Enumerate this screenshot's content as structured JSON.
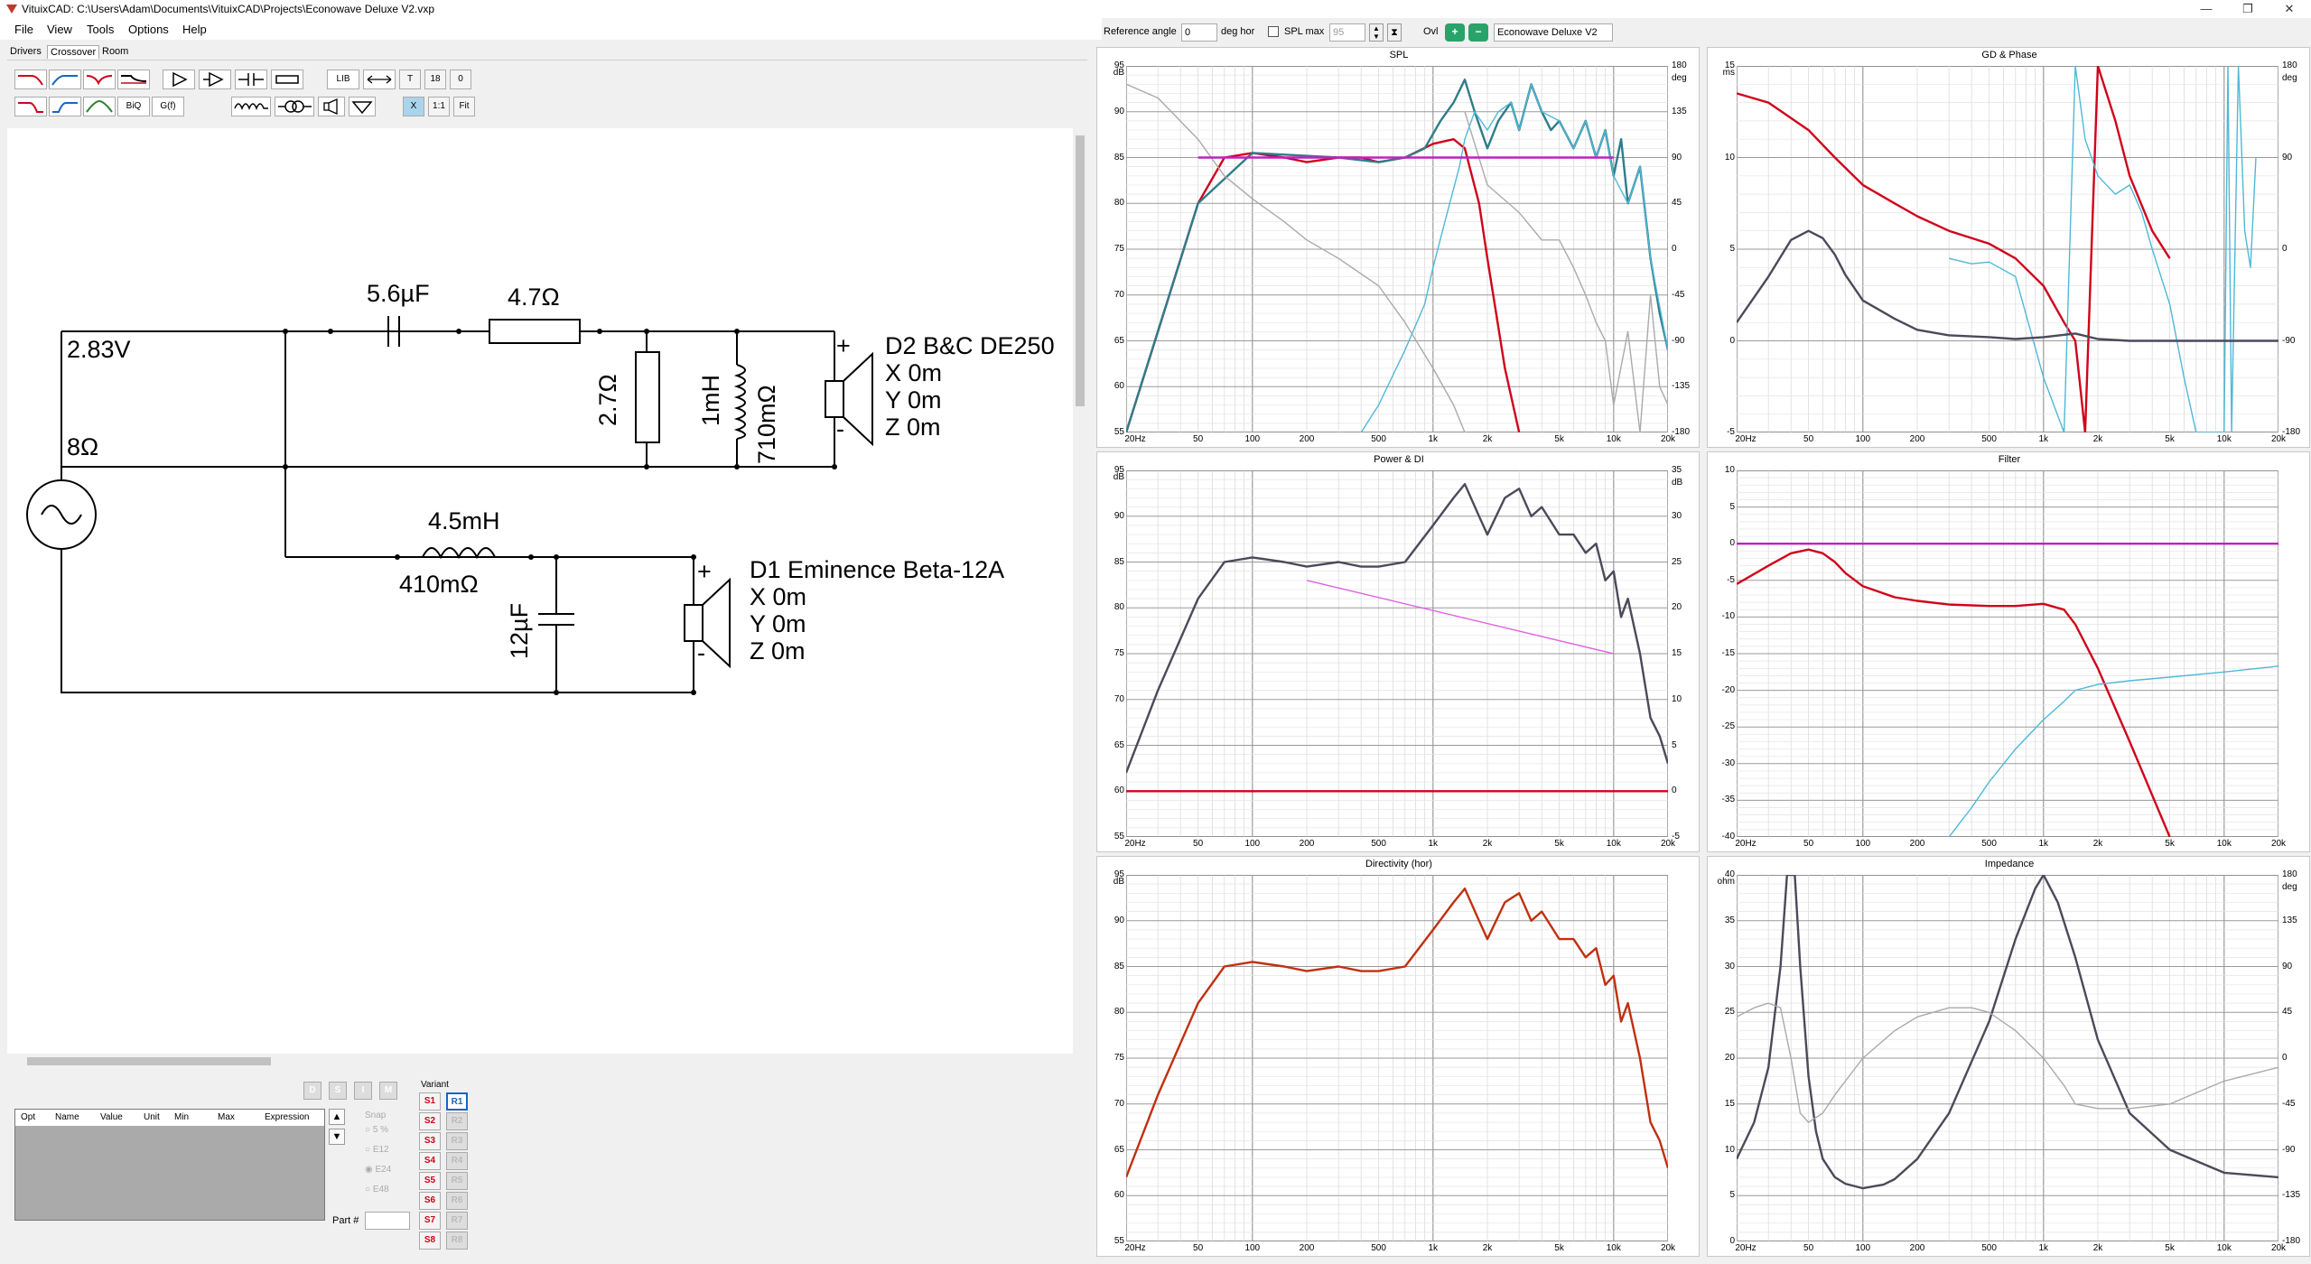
{
  "window": {
    "title": "VituixCAD: C:\\Users\\Adam\\Documents\\VituixCAD\\Projects\\Econowave Deluxe V2.vxp",
    "min": "—",
    "max": "❐",
    "close": "✕"
  },
  "menu": [
    "File",
    "View",
    "Tools",
    "Options",
    "Help"
  ],
  "tabs": [
    "Drivers",
    "Crossover",
    "Room"
  ],
  "toolbar": {
    "lib": "LIB",
    "biq": "BiQ",
    "gf": "G(f)",
    "t": "T",
    "n18": "18",
    "n0": "0",
    "x": "X",
    "one": "1:1",
    "fit": "Fit"
  },
  "schematic": {
    "source": {
      "voltage": "2.83V",
      "impedance": "8Ω"
    },
    "components": {
      "c_hf": "5.6µF",
      "r_series": "4.7Ω",
      "r_shunt": "2.7Ω",
      "l_shunt": "1mH",
      "l_shunt_r": "710mΩ",
      "l_lf": "4.5mH",
      "l_lf_r": "410mΩ",
      "c_lf": "12µF"
    },
    "drivers": [
      {
        "name": "D2 B&C DE250",
        "x": "X 0m",
        "y": "Y 0m",
        "z": "Z 0m"
      },
      {
        "name": "D1 Eminence Beta-12A",
        "x": "X 0m",
        "y": "Y 0m",
        "z": "Z 0m"
      }
    ],
    "plus": "+",
    "minus": "-"
  },
  "parts_table": {
    "columns": [
      "Opt",
      "Name",
      "Value",
      "Unit",
      "Min",
      "Max",
      "Expression"
    ]
  },
  "flip": {
    "d": "D",
    "s": "S",
    "i": "I",
    "m": "M"
  },
  "snap": {
    "label": "Snap",
    "options": [
      "5 %",
      "E12",
      "E24",
      "E48"
    ],
    "selected": "E24"
  },
  "part_label": "Part #",
  "variant": {
    "label": "Variant",
    "s": [
      "S1",
      "S2",
      "S3",
      "S4",
      "S5",
      "S6",
      "S7",
      "S8"
    ],
    "r": [
      "R1",
      "R2",
      "R3",
      "R4",
      "R5",
      "R6",
      "R7",
      "R8"
    ]
  },
  "top_controls": {
    "ref_angle_label": "Reference angle",
    "ref_angle": "0",
    "deg_hor": "deg hor",
    "spl_max_label": "SPL max",
    "spl_max": "95",
    "ovl_label": "Ovl",
    "variant_name": "Econowave Deluxe V2"
  },
  "xticks": [
    "20Hz",
    "50",
    "100",
    "200",
    "500",
    "1k",
    "2k",
    "5k",
    "10k",
    "20k"
  ],
  "colors": {
    "red": "#d0021b",
    "teal": "#2e7d89",
    "cyan": "#4fb8d8",
    "gray": "#aaaaaa",
    "dark": "#4a4a5a",
    "magenta": "#c020c0",
    "pink": "#e060e0",
    "dirline": "#c03010"
  },
  "panels": [
    {
      "id": "spl",
      "title": "SPL",
      "unit": "dB",
      "unit2": "deg",
      "y": [
        "95",
        "90",
        "85",
        "80",
        "75",
        "70",
        "65",
        "60",
        "55"
      ],
      "y2": [
        "180",
        "135",
        "90",
        "45",
        "0",
        "-45",
        "-90",
        "-135",
        "-180"
      ]
    },
    {
      "id": "gd",
      "title": "GD & Phase",
      "unit": "ms",
      "unit2": "deg",
      "y": [
        "15",
        "10",
        "5",
        "0",
        "-5"
      ],
      "y2": [
        "180",
        "90",
        "0",
        "-90",
        "-180"
      ]
    },
    {
      "id": "power",
      "title": "Power & DI",
      "unit": "dB",
      "unit2": "dB",
      "y": [
        "95",
        "90",
        "85",
        "80",
        "75",
        "70",
        "65",
        "60",
        "55"
      ],
      "y2": [
        "35",
        "30",
        "25",
        "20",
        "15",
        "10",
        "5",
        "0",
        "-5"
      ]
    },
    {
      "id": "filter",
      "title": "Filter",
      "unit": "",
      "unit2": "",
      "y": [
        "10",
        "5",
        "0",
        "-5",
        "-10",
        "-15",
        "-20",
        "-25",
        "-30",
        "-35",
        "-40"
      ],
      "y2": []
    },
    {
      "id": "dir",
      "title": "Directivity (hor)",
      "unit": "dB",
      "unit2": "",
      "y": [
        "95",
        "90",
        "85",
        "80",
        "75",
        "70",
        "65",
        "60",
        "55"
      ],
      "y2": []
    },
    {
      "id": "imp",
      "title": "Impedance",
      "unit": "ohm",
      "unit2": "deg",
      "y": [
        "40",
        "35",
        "30",
        "25",
        "20",
        "15",
        "10",
        "5",
        "0"
      ],
      "y2": [
        "180",
        "135",
        "90",
        "45",
        "0",
        "-45",
        "-90",
        "-135",
        "-180"
      ]
    }
  ],
  "chart_data": [
    {
      "type": "line",
      "title": "SPL",
      "ylim": [
        55,
        95
      ],
      "y2lim": [
        -180,
        180
      ],
      "xscale": "log",
      "xlim": [
        20,
        20000
      ],
      "series": [
        {
          "color": "#d0021b",
          "x": [
            20,
            30,
            50,
            70,
            100,
            150,
            200,
            300,
            400,
            500,
            700,
            1000,
            1300,
            1500,
            1800,
            2000,
            2500,
            3000
          ],
          "y": [
            55,
            66,
            80,
            85,
            85.5,
            85,
            84.5,
            85,
            85,
            84.5,
            85,
            86.5,
            87,
            86,
            80,
            74,
            62,
            55
          ]
        },
        {
          "color": "#2e7d89",
          "x": [
            20,
            50,
            100,
            300,
            500,
            700,
            900,
            1100,
            1300,
            1500,
            1700,
            2000,
            2300,
            2700,
            3000,
            3500,
            4000,
            4500,
            5000,
            6000,
            7000,
            8000,
            9000,
            10000,
            11000,
            12000,
            14000,
            16000,
            18000,
            20000
          ],
          "y": [
            55,
            80,
            85.5,
            85,
            84.5,
            85,
            86,
            89,
            91,
            93.5,
            90,
            86,
            89,
            91,
            88,
            93,
            90,
            88,
            89,
            86,
            89,
            85,
            88,
            83,
            87,
            80,
            84,
            74,
            68,
            64
          ]
        },
        {
          "color": "#4fb8d8",
          "x": [
            400,
            500,
            700,
            900,
            1000,
            1200,
            1400,
            1500,
            1700,
            2000,
            2300,
            2700,
            3000,
            3500,
            4000,
            5000,
            6000,
            7000,
            8000,
            9000,
            10000,
            12000,
            14000,
            16000,
            20000
          ],
          "y": [
            55,
            58,
            64,
            69,
            73,
            79,
            84,
            87,
            90,
            88,
            90,
            91,
            88,
            93,
            90,
            89,
            86,
            89,
            85,
            88,
            83,
            80,
            84,
            74,
            64
          ]
        },
        {
          "color": "#aaaaaa",
          "x": [
            20,
            30,
            50,
            70,
            100,
            150,
            200,
            300,
            500,
            700,
            1000,
            1300,
            1500
          ],
          "y": [
            93,
            91.5,
            87,
            83,
            80.5,
            78,
            76,
            74,
            71,
            67,
            62,
            58,
            55
          ]
        },
        {
          "color": "#aaaaaa",
          "x": [
            1500,
            2000,
            3000,
            4000,
            5000,
            6000,
            7000,
            8000,
            9000,
            10000,
            12000,
            14000,
            16000,
            18000,
            20000
          ],
          "y": [
            90,
            82,
            79,
            76,
            76,
            73,
            70,
            67,
            65,
            58,
            66,
            55,
            70,
            60,
            58
          ]
        },
        {
          "color": "#c020c0",
          "x": [
            50,
            10000
          ],
          "y": [
            85,
            85
          ]
        }
      ]
    },
    {
      "type": "line",
      "title": "GD & Phase",
      "ylim": [
        -5,
        15
      ],
      "y2lim": [
        -180,
        180
      ],
      "xscale": "log",
      "xlim": [
        20,
        20000
      ],
      "series": [
        {
          "color": "#d0021b",
          "x": [
            20,
            30,
            50,
            70,
            100,
            150,
            200,
            300,
            500,
            700,
            1000,
            1300,
            1500,
            1700,
            2000,
            2500,
            3000,
            4000,
            5000
          ],
          "y": [
            13.5,
            13,
            11.5,
            10,
            8.5,
            7.5,
            6.8,
            6,
            5.3,
            4.5,
            3,
            1,
            0,
            -5,
            15,
            12,
            9,
            6,
            4.5
          ]
        },
        {
          "color": "#4fb8d8",
          "x": [
            300,
            400,
            500,
            700,
            1000,
            1300,
            1500,
            1700,
            2000,
            2500,
            3000,
            3500,
            4000,
            5000,
            6000,
            7000,
            8000,
            9000,
            10000,
            10500,
            11000,
            12000,
            13000,
            14000,
            15000
          ],
          "y": [
            4.5,
            4.2,
            4.3,
            3.5,
            -2,
            -5,
            15,
            11,
            9,
            8,
            8.5,
            7,
            5,
            2,
            -2,
            -5,
            -5,
            -5,
            -5,
            15,
            -5,
            15,
            6,
            4,
            10
          ]
        },
        {
          "color": "#4a4a5a",
          "x": [
            20,
            30,
            40,
            50,
            60,
            70,
            80,
            100,
            150,
            200,
            300,
            500,
            700,
            1000,
            1500,
            2000,
            3000,
            5000,
            10000,
            20000
          ],
          "y": [
            1,
            3.5,
            5.5,
            6,
            5.6,
            4.7,
            3.6,
            2.2,
            1.2,
            0.6,
            0.3,
            0.2,
            0.1,
            0.2,
            0.4,
            0.1,
            0,
            0,
            0,
            0
          ]
        }
      ]
    },
    {
      "type": "line",
      "title": "Power & DI",
      "ylim": [
        55,
        95
      ],
      "y2lim": [
        -5,
        35
      ],
      "xscale": "log",
      "xlim": [
        20,
        20000
      ],
      "series": [
        {
          "color": "#4a4a5a",
          "x": [
            20,
            30,
            50,
            70,
            100,
            150,
            200,
            300,
            400,
            500,
            700,
            1000,
            1300,
            1500,
            1800,
            2000,
            2500,
            3000,
            3500,
            4000,
            5000,
            6000,
            7000,
            8000,
            9000,
            10000,
            11000,
            12000,
            14000,
            16000,
            18000,
            20000
          ],
          "y": [
            62,
            71,
            81,
            85,
            85.5,
            85,
            84.5,
            85,
            84.5,
            84.5,
            85,
            89,
            92,
            93.5,
            90,
            88,
            92,
            93,
            90,
            91,
            88,
            88,
            86,
            87,
            83,
            84,
            79,
            81,
            75,
            68,
            66,
            63
          ]
        },
        {
          "color": "#e060e0",
          "x": [
            200,
            10000
          ],
          "y": [
            83,
            75
          ]
        },
        {
          "color": "#d0021b",
          "x": [
            20,
            20000
          ],
          "y": [
            60,
            60
          ]
        }
      ]
    },
    {
      "type": "line",
      "title": "Filter",
      "ylim": [
        -40,
        10
      ],
      "xscale": "log",
      "xlim": [
        20,
        20000
      ],
      "series": [
        {
          "color": "#c020c0",
          "x": [
            20,
            20000
          ],
          "y": [
            0,
            0
          ]
        },
        {
          "color": "#d0021b",
          "x": [
            20,
            30,
            40,
            50,
            60,
            70,
            80,
            100,
            150,
            200,
            300,
            500,
            700,
            1000,
            1300,
            1500,
            2000,
            3000,
            5000
          ],
          "y": [
            -5.5,
            -3,
            -1.3,
            -0.8,
            -1.3,
            -2.5,
            -4,
            -5.8,
            -7.3,
            -7.8,
            -8.3,
            -8.5,
            -8.5,
            -8.2,
            -9,
            -11,
            -17,
            -27,
            -40
          ]
        },
        {
          "color": "#4fb8d8",
          "x": [
            300,
            400,
            500,
            700,
            1000,
            1300,
            1500,
            2000,
            3000,
            5000,
            10000,
            20000
          ],
          "y": [
            -40,
            -36,
            -32.5,
            -28,
            -24,
            -21.5,
            -20,
            -19.2,
            -18.7,
            -18.2,
            -17.5,
            -16.7
          ]
        }
      ]
    },
    {
      "type": "line",
      "title": "Directivity (hor)",
      "ylim": [
        55,
        95
      ],
      "xscale": "log",
      "xlim": [
        20,
        20000
      ],
      "series": [
        {
          "color": "#c03010",
          "x": [
            20,
            30,
            50,
            70,
            100,
            150,
            200,
            300,
            400,
            500,
            700,
            1000,
            1300,
            1500,
            1800,
            2000,
            2500,
            3000,
            3500,
            4000,
            5000,
            6000,
            7000,
            8000,
            9000,
            10000,
            11000,
            12000,
            14000,
            16000,
            18000,
            20000
          ],
          "y": [
            62,
            71,
            81,
            85,
            85.5,
            85,
            84.5,
            85,
            84.5,
            84.5,
            85,
            89,
            92,
            93.5,
            90,
            88,
            92,
            93,
            90,
            91,
            88,
            88,
            86,
            87,
            83,
            84,
            79,
            81,
            75,
            68,
            66,
            63
          ]
        }
      ]
    },
    {
      "type": "line",
      "title": "Impedance",
      "ylim": [
        0,
        40
      ],
      "y2lim": [
        -180,
        180
      ],
      "xscale": "log",
      "xlim": [
        20,
        20000
      ],
      "series": [
        {
          "color": "#4a4a5a",
          "x": [
            20,
            25,
            30,
            35,
            38,
            40,
            42,
            45,
            50,
            55,
            60,
            70,
            80,
            100,
            130,
            150,
            200,
            300,
            500,
            700,
            900,
            1000,
            1200,
            1500,
            2000,
            3000,
            5000,
            10000,
            20000
          ],
          "y": [
            9,
            13,
            19,
            30,
            40,
            40,
            40,
            30,
            18,
            12,
            9,
            7,
            6.3,
            5.8,
            6.2,
            6.8,
            9,
            14,
            24,
            33,
            38.5,
            40,
            37,
            31,
            22,
            14,
            10,
            7.5,
            7
          ]
        },
        {
          "color": "#aaaaaa",
          "x": [
            20,
            25,
            30,
            35,
            40,
            45,
            50,
            60,
            70,
            100,
            150,
            200,
            300,
            400,
            500,
            700,
            1000,
            1300,
            1500,
            2000,
            3000,
            5000,
            10000,
            20000
          ],
          "y": [
            24.5,
            25.5,
            26,
            25.5,
            20,
            14,
            13,
            14,
            16,
            20,
            23,
            24.5,
            25.5,
            25.5,
            25,
            23,
            20,
            17,
            15,
            14.5,
            14.5,
            15,
            17.5,
            19
          ]
        }
      ]
    }
  ]
}
